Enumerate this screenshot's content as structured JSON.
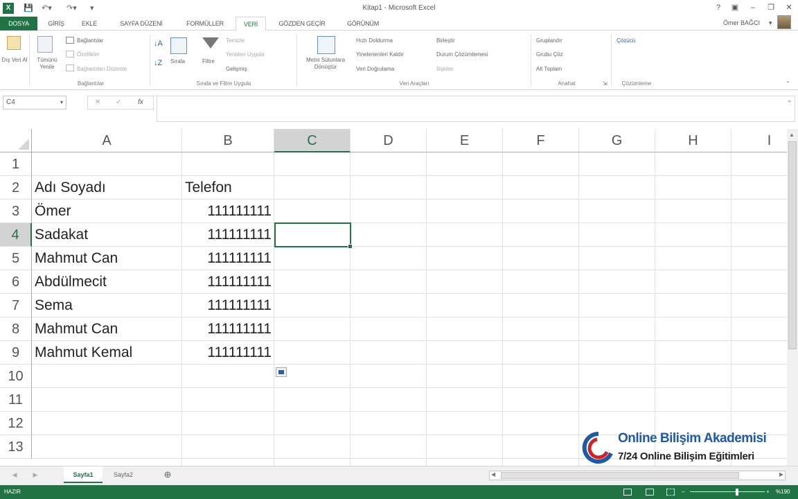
{
  "window": {
    "title": "Kitap1 - Microsoft Excel",
    "user": "Ömer BAĞCI",
    "help": "?",
    "controls": [
      "▣",
      "–",
      "❐",
      "✕"
    ]
  },
  "ribbon_tabs": [
    {
      "label": "DOSYA",
      "kind": "file"
    },
    {
      "label": "GİRİŞ",
      "kind": "normal"
    },
    {
      "label": "EKLE",
      "kind": "normal"
    },
    {
      "label": "SAYFA DÜZENİ",
      "kind": "normal"
    },
    {
      "label": "FORMÜLLER",
      "kind": "normal"
    },
    {
      "label": "VERİ",
      "kind": "active"
    },
    {
      "label": "GÖZDEN GEÇİR",
      "kind": "normal"
    },
    {
      "label": "GÖRÜNÜM",
      "kind": "normal"
    }
  ],
  "ribbon": {
    "external_data": "Dış Veri Al",
    "refresh_all": "Tümünü Yenile",
    "connections": "Bağlantılar",
    "properties": "Özellikler",
    "edit_links": "Bağlantıları Düzenle",
    "sort": "Sırala",
    "filter": "Filtre",
    "clear": "Temizle",
    "reapply": "Yeniden Uygula",
    "advanced": "Gelişmiş",
    "text_to_columns": "Metni Sütunlara Dönüştür",
    "flash_fill": "Hızlı Doldurma",
    "remove_duplicates": "Yinelenenleri Kaldır",
    "data_validation": "Veri Doğrulama",
    "consolidate": "Birleştir",
    "what_if": "Durum Çözümlemesi",
    "relationships": "İlişkiler",
    "group": "Gruplandır",
    "ungroup": "Grubu Çöz",
    "subtotal": "Alt Toplam",
    "solver": "Çözücü",
    "groups": {
      "connections": "Bağlantılar",
      "sort_filter": "Sırala ve Filtre Uygula",
      "data_tools": "Veri Araçları",
      "outline": "Anahat",
      "analysis": "Çözümleme"
    }
  },
  "formula_bar": {
    "name_box": "C4",
    "fx": "fx",
    "value": ""
  },
  "columns": [
    "A",
    "B",
    "C",
    "D",
    "E",
    "F",
    "G",
    "H",
    "I"
  ],
  "rows": [
    "1",
    "2",
    "3",
    "4",
    "5",
    "6",
    "7",
    "8",
    "9",
    "10",
    "11",
    "12",
    "13"
  ],
  "cells": {
    "header_name": "Adı Soyadı",
    "header_phone": "Telefon",
    "data": [
      {
        "name": "Ömer",
        "phone": "111111111"
      },
      {
        "name": "Sadakat",
        "phone": "111111111"
      },
      {
        "name": "Mahmut Can",
        "phone": "111111111"
      },
      {
        "name": "Abdülmecit",
        "phone": "111111111"
      },
      {
        "name": "Sema",
        "phone": "111111111"
      },
      {
        "name": "Mahmut Can",
        "phone": "111111111"
      },
      {
        "name": "Mahmut Kemal",
        "phone": "111111111"
      }
    ]
  },
  "active_cell": "C4",
  "sheets": [
    {
      "label": "Sayfa1",
      "active": true
    },
    {
      "label": "Sayfa2",
      "active": false
    }
  ],
  "status": {
    "ready": "HAZIR",
    "zoom": "%190"
  },
  "watermark": {
    "line1": "Online Bilişim Akademisi",
    "line2": "7/24 Online Bilişim Eğitimleri"
  },
  "colors": {
    "accent": "#217346",
    "watermark_blue": "#1f5aa6",
    "watermark_red": "#d0202a"
  }
}
